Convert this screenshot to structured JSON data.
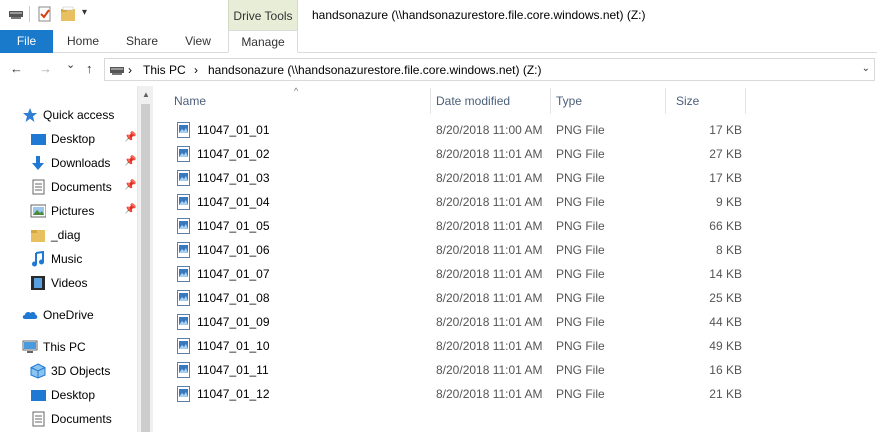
{
  "titlebar": {
    "context_tab_label": "Drive Tools",
    "window_title": "handsonazure (\\\\handsonazurestore.file.core.windows.net) (Z:)",
    "dropdown_glyph": "▾"
  },
  "ribbon": {
    "tabs": [
      "File",
      "Home",
      "Share",
      "View",
      "Manage"
    ]
  },
  "nav": {
    "back": "←",
    "forward": "→",
    "recent": "⌄",
    "up": "↑"
  },
  "address": {
    "separator": "›",
    "this_pc": "This PC",
    "drive": "handsonazure (\\\\handsonazurestore.file.core.windows.net) (Z:)",
    "dropdown": "⌄"
  },
  "sidebar": {
    "scroll_up": "▲",
    "pin_glyph": "📌",
    "quick_access": "Quick access",
    "quick_items": [
      "Desktop",
      "Downloads",
      "Documents",
      "Pictures",
      "_diag",
      "Music",
      "Videos"
    ],
    "onedrive": "OneDrive",
    "this_pc": "This PC",
    "pc_items": [
      "3D Objects",
      "Desktop",
      "Documents"
    ]
  },
  "columns": {
    "name": "Name",
    "date": "Date modified",
    "type": "Type",
    "size": "Size",
    "sort_glyph": "^"
  },
  "files": [
    {
      "name": "11047_01_01",
      "date": "8/20/2018 11:00 AM",
      "type": "PNG File",
      "size": "17 KB"
    },
    {
      "name": "11047_01_02",
      "date": "8/20/2018 11:01 AM",
      "type": "PNG File",
      "size": "27 KB"
    },
    {
      "name": "11047_01_03",
      "date": "8/20/2018 11:01 AM",
      "type": "PNG File",
      "size": "17 KB"
    },
    {
      "name": "11047_01_04",
      "date": "8/20/2018 11:01 AM",
      "type": "PNG File",
      "size": "9 KB"
    },
    {
      "name": "11047_01_05",
      "date": "8/20/2018 11:01 AM",
      "type": "PNG File",
      "size": "66 KB"
    },
    {
      "name": "11047_01_06",
      "date": "8/20/2018 11:01 AM",
      "type": "PNG File",
      "size": "8 KB"
    },
    {
      "name": "11047_01_07",
      "date": "8/20/2018 11:01 AM",
      "type": "PNG File",
      "size": "14 KB"
    },
    {
      "name": "11047_01_08",
      "date": "8/20/2018 11:01 AM",
      "type": "PNG File",
      "size": "25 KB"
    },
    {
      "name": "11047_01_09",
      "date": "8/20/2018 11:01 AM",
      "type": "PNG File",
      "size": "44 KB"
    },
    {
      "name": "11047_01_10",
      "date": "8/20/2018 11:01 AM",
      "type": "PNG File",
      "size": "49 KB"
    },
    {
      "name": "11047_01_11",
      "date": "8/20/2018 11:01 AM",
      "type": "PNG File",
      "size": "16 KB"
    },
    {
      "name": "11047_01_12",
      "date": "8/20/2018 11:01 AM",
      "type": "PNG File",
      "size": "21 KB"
    }
  ],
  "colors": {
    "accent": "#1979ca",
    "context_tab": "#e8edd8",
    "header_text": "#4c607a"
  }
}
